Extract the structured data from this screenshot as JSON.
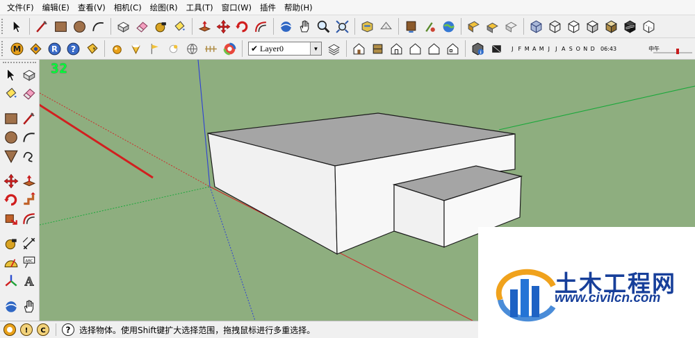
{
  "menubar": {
    "items": [
      "文件(F)",
      "编辑(E)",
      "查看(V)",
      "相机(C)",
      "绘图(R)",
      "工具(T)",
      "窗口(W)",
      "插件",
      "帮助(H)"
    ]
  },
  "layers": {
    "current": "Layer0"
  },
  "shadows": {
    "months": [
      "J",
      "F",
      "M",
      "A",
      "M",
      "J",
      "J",
      "A",
      "S",
      "O",
      "N",
      "D"
    ],
    "time": "06:43",
    "noon_label": "中午"
  },
  "viewport": {
    "counter": "32",
    "background": "#8eae7f"
  },
  "statusbar": {
    "message": "选择物体。使用Shift键扩大选择范围，拖拽鼠标进行多重选择。"
  },
  "watermark": {
    "title": "土木工程网",
    "url": "www.civilcn.com"
  },
  "colors": {
    "accent_arrow": "#d21f1f",
    "watermark_blue": "#173f9a",
    "roof": "#a5a5a5",
    "wall": "#f5f5f5"
  }
}
